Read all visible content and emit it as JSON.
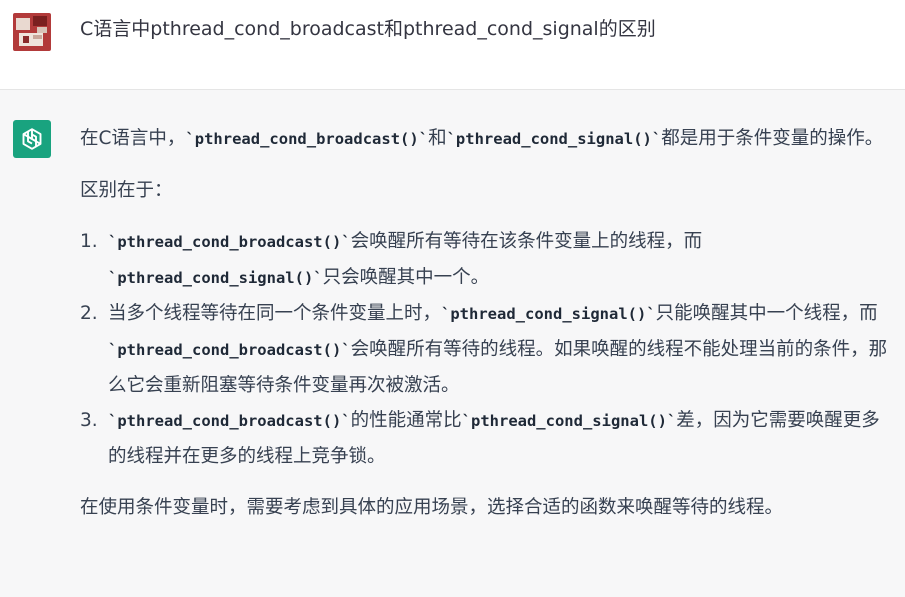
{
  "user": {
    "question": "C语言中pthread_cond_broadcast和pthread_cond_signal的区别"
  },
  "assistant": {
    "intro": {
      "before": "在C语言中，",
      "code1": "`pthread_cond_broadcast()`",
      "mid": "和",
      "code2": "`pthread_cond_signal()`",
      "after": "都是用于条件变量的操作。"
    },
    "diff_label": "区别在于：",
    "items": [
      {
        "num": "1.",
        "code1": "`pthread_cond_broadcast()`",
        "t1": "会唤醒所有等待在该条件变量上的线程，而",
        "code2": "`pthread_cond_signal()`",
        "t2": "只会唤醒其中一个。"
      },
      {
        "num": "2.",
        "t0": "当多个线程等待在同一个条件变量上时，",
        "code1": "`pthread_cond_signal()`",
        "t1": "只能唤醒其中一个线程，而",
        "code2": "`pthread_cond_broadcast()`",
        "t2": "会唤醒所有等待的线程。如果唤醒的线程不能处理当前的条件，那么它会重新阻塞等待条件变量再次被激活。"
      },
      {
        "num": "3.",
        "code1": "`pthread_cond_broadcast()`",
        "t1": "的性能通常比",
        "code2": "`pthread_cond_signal()`",
        "t2": "差，因为它需要唤醒更多的线程并在更多的线程上竞争锁。"
      }
    ],
    "conclusion": "在使用条件变量时，需要考虑到具体的应用场景，选择合适的函数来唤醒等待的线程。"
  },
  "colors": {
    "gpt_avatar_bg": "#19a37f",
    "assistant_bg": "#f7f7f8",
    "text": "#374151"
  },
  "icons": {
    "user": "user-avatar-image",
    "assistant": "openai-logo-icon"
  }
}
